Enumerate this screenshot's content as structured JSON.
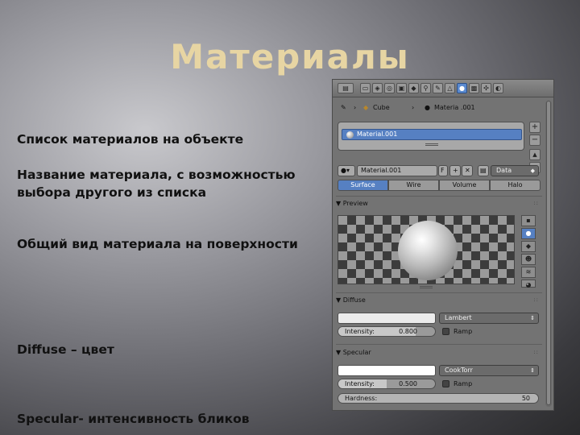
{
  "slide": {
    "title": "Материалы",
    "notes": [
      "Список материалов на объекте",
      "Название материала, с возможностью выбора другого из списка",
      "Общий вид материала на поверхности",
      "Diffuse – цвет",
      "Specular- интенсивность бликов"
    ]
  },
  "panel": {
    "breadcrumb": {
      "object": "Cube",
      "material": "Materia .001"
    },
    "material_list": {
      "items": [
        "Material.001"
      ]
    },
    "list_buttons": [
      "+",
      "−",
      "▲",
      "▼"
    ],
    "material_name": "Material.001",
    "f_label": "F",
    "data_dropdown": "Data",
    "tabs": [
      "Surface",
      "Wire",
      "Volume",
      "Halo"
    ],
    "active_tab": 0,
    "preview": {
      "header": "Preview"
    },
    "diffuse": {
      "header": "Diffuse",
      "color": "#ebebeb",
      "shader": "Lambert",
      "intensity_label": "Intensity:",
      "intensity_value": "0.800",
      "intensity_fraction": 0.8,
      "ramp_label": "Ramp"
    },
    "specular": {
      "header": "Specular",
      "color": "#ffffff",
      "shader": "CookTorr",
      "intensity_label": "Intensity:",
      "intensity_value": "0.500",
      "intensity_fraction": 0.5,
      "ramp_label": "Ramp",
      "hardness_label": "Hardness:",
      "hardness_value": "50"
    },
    "colors": {
      "accent": "#5680c2",
      "panel_bg": "#737373"
    }
  }
}
